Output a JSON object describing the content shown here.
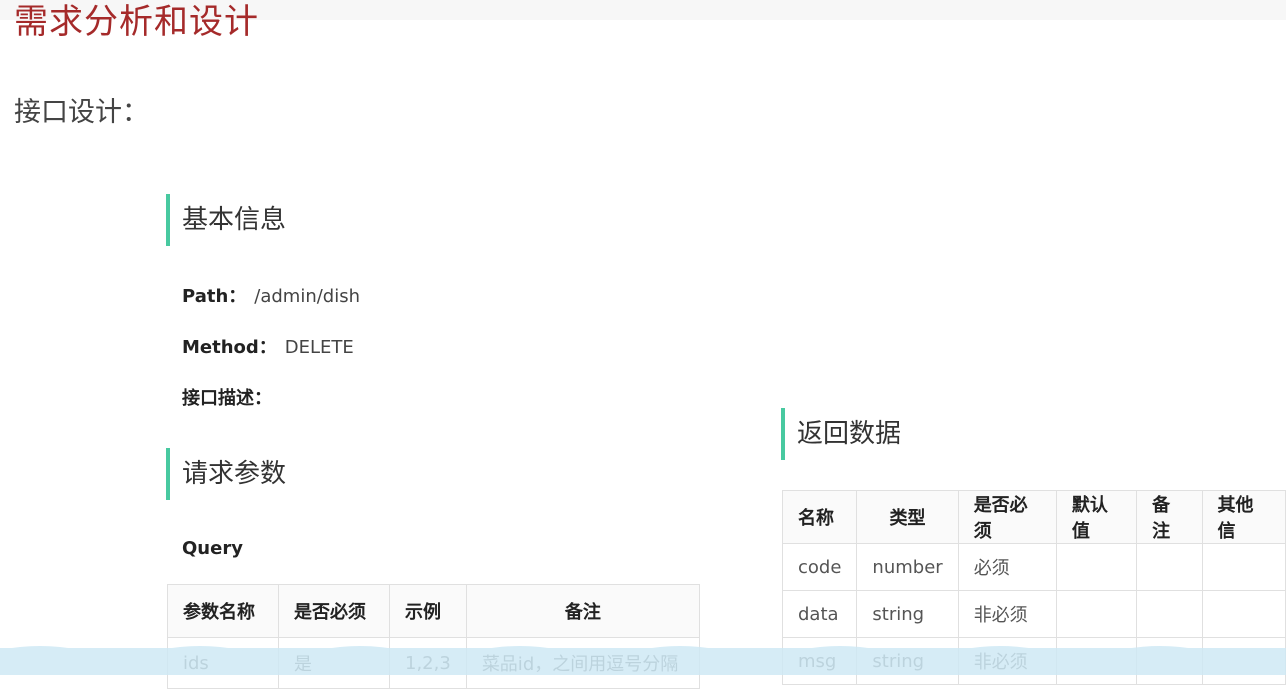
{
  "page": {
    "title": "需求分析和设计",
    "subtitle": "接口设计："
  },
  "basic_info": {
    "heading": "基本信息",
    "path_label": "Path：",
    "path_value": "/admin/dish",
    "method_label": "Method：",
    "method_value": "DELETE",
    "desc_label": "接口描述："
  },
  "request": {
    "heading": "请求参数",
    "query_label": "Query",
    "columns": [
      "参数名称",
      "是否必须",
      "示例",
      "备注"
    ],
    "rows": [
      [
        "ids",
        "是",
        "1,2,3",
        "菜品id，之间用逗号分隔"
      ]
    ]
  },
  "response": {
    "heading": "返回数据",
    "columns": [
      "名称",
      "类型",
      "是否必须",
      "默认值",
      "备注",
      "其他信"
    ],
    "rows": [
      [
        "code",
        "number",
        "必须",
        "",
        "",
        ""
      ],
      [
        "data",
        "string",
        "非必须",
        "",
        "",
        ""
      ],
      [
        "msg",
        "string",
        "非必须",
        "",
        "",
        ""
      ]
    ]
  },
  "colors": {
    "title": "#a52a2a",
    "accent_bar": "#48c9a0",
    "wave": "#cfe9f5"
  }
}
